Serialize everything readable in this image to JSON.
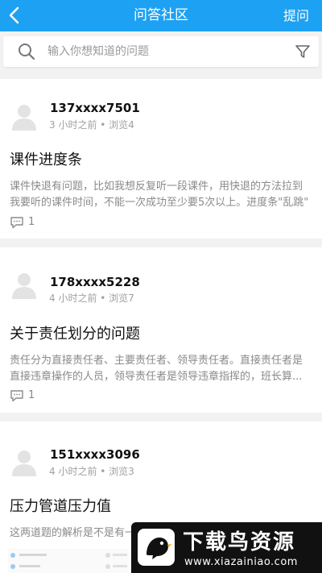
{
  "nav": {
    "title": "问答社区",
    "ask_label": "提问"
  },
  "search": {
    "placeholder": "输入你想知道的问题"
  },
  "questions": [
    {
      "user": "137xxxx7501",
      "meta": "3 小时之前 • 浏览4",
      "title": "课件进度条",
      "body": "课件快退有问题，比如我想反复听一段课件，用快退的方法拉到我要听的课件时间，不能一次成功至少要5次以上。进度条\"乱跳\"",
      "comments": "1"
    },
    {
      "user": "178xxxx5228",
      "meta": "4 小时之前 • 浏览7",
      "title": "关于责任划分的问题",
      "body": "责任分为直接责任者、主要责任者、领导责任者。直接责任者是直接违章操作的人员，领导责任者是领导违章指挥的，班长算...",
      "comments": "1"
    },
    {
      "user": "151xxxx3096",
      "meta": "4 小时之前 • 浏览3",
      "title": "压力管道压力值",
      "body": "这两道题的解析是不是有一"
    }
  ],
  "watermark": {
    "title": "下载鸟资源",
    "url": "www.xiazainiao.com"
  },
  "colors": {
    "brand": "#1da1f2",
    "text_muted": "#8a8a8a"
  }
}
